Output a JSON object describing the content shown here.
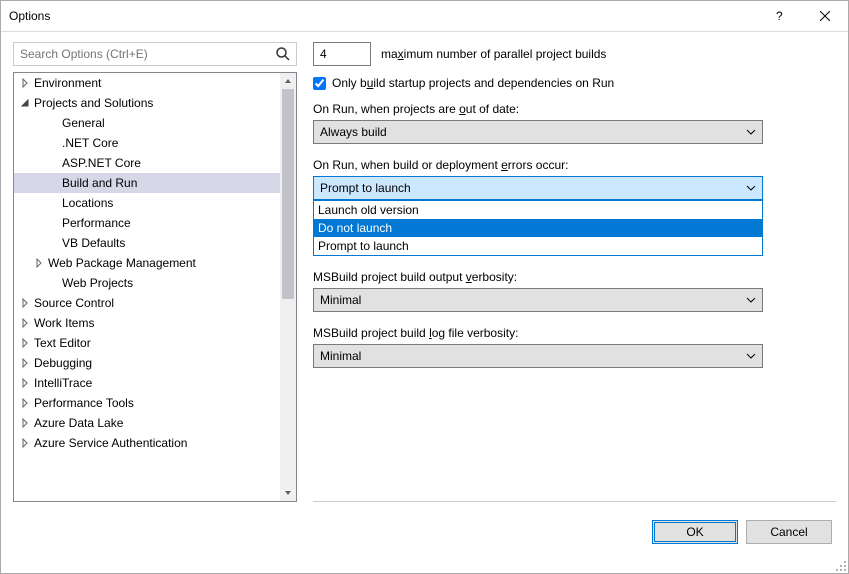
{
  "window": {
    "title": "Options"
  },
  "search": {
    "placeholder": "Search Options (Ctrl+E)"
  },
  "tree": {
    "items": [
      {
        "label": "Environment",
        "indent": 1,
        "twisty": "closed"
      },
      {
        "label": "Projects and Solutions",
        "indent": 1,
        "twisty": "open"
      },
      {
        "label": "General",
        "indent": 3,
        "twisty": "none"
      },
      {
        "label": ".NET Core",
        "indent": 3,
        "twisty": "none"
      },
      {
        "label": "ASP.NET Core",
        "indent": 3,
        "twisty": "none"
      },
      {
        "label": "Build and Run",
        "indent": 3,
        "twisty": "none",
        "selected": true
      },
      {
        "label": "Locations",
        "indent": 3,
        "twisty": "none"
      },
      {
        "label": "Performance",
        "indent": 3,
        "twisty": "none"
      },
      {
        "label": "VB Defaults",
        "indent": 3,
        "twisty": "none"
      },
      {
        "label": "Web Package Management",
        "indent": 2,
        "twisty": "closed"
      },
      {
        "label": "Web Projects",
        "indent": 3,
        "twisty": "none"
      },
      {
        "label": "Source Control",
        "indent": 1,
        "twisty": "closed"
      },
      {
        "label": "Work Items",
        "indent": 1,
        "twisty": "closed"
      },
      {
        "label": "Text Editor",
        "indent": 1,
        "twisty": "closed"
      },
      {
        "label": "Debugging",
        "indent": 1,
        "twisty": "closed"
      },
      {
        "label": "IntelliTrace",
        "indent": 1,
        "twisty": "closed"
      },
      {
        "label": "Performance Tools",
        "indent": 1,
        "twisty": "closed"
      },
      {
        "label": "Azure Data Lake",
        "indent": 1,
        "twisty": "closed"
      },
      {
        "label": "Azure Service Authentication",
        "indent": 1,
        "twisty": "closed"
      }
    ]
  },
  "main": {
    "parallel_builds_value": "4",
    "parallel_builds_label_pre": "ma",
    "parallel_builds_label_access": "x",
    "parallel_builds_label_post": "imum number of parallel project builds",
    "only_build_startup_checked": true,
    "only_build_startup_pre": "Only b",
    "only_build_startup_access": "u",
    "only_build_startup_post": "ild startup projects and dependencies on Run",
    "out_of_date_label_pre": "On Run, when projects are ",
    "out_of_date_label_access": "o",
    "out_of_date_label_post": "ut of date:",
    "out_of_date_value": "Always build",
    "errors_label_pre": "On Run, when build or deployment ",
    "errors_label_access": "e",
    "errors_label_post": "rrors occur:",
    "errors_value": "Prompt to launch",
    "errors_options": [
      {
        "label": "Launch old version",
        "hl": false
      },
      {
        "label": "Do not launch",
        "hl": true
      },
      {
        "label": "Prompt to launch",
        "hl": false
      }
    ],
    "output_verbosity_label_pre": "MSBuild project build output ",
    "output_verbosity_label_access": "v",
    "output_verbosity_label_post": "erbosity:",
    "output_verbosity_value": "Minimal",
    "log_verbosity_label_pre": "MSBuild project build ",
    "log_verbosity_label_access": "l",
    "log_verbosity_label_post": "og file verbosity:",
    "log_verbosity_value": "Minimal"
  },
  "footer": {
    "ok": "OK",
    "cancel": "Cancel"
  }
}
